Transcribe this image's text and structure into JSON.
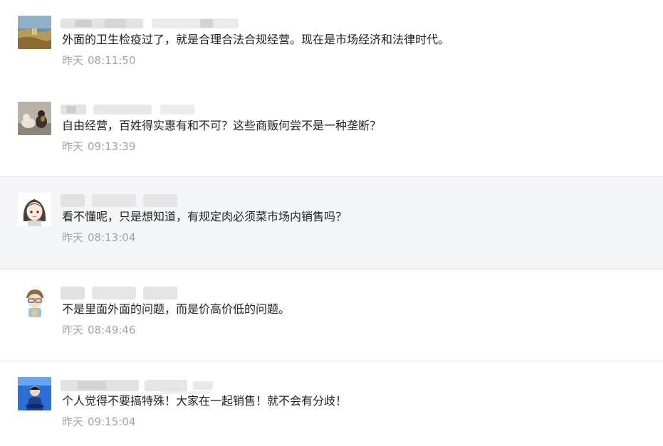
{
  "comments": [
    {
      "avatar": "landscape-avatar",
      "text": "外面的卫生检疫过了，就是合理合法合规经营。现在是市场经济和法律时代。",
      "day": "昨天",
      "time": "08:11:50"
    },
    {
      "avatar": "dogs-avatar",
      "text": "自由经营，百姓得实惠有和不可？这些商贩何尝不是一种垄断？",
      "day": "昨天",
      "time": "09:13:39"
    },
    {
      "avatar": "girl-cartoon-avatar",
      "text": "看不懂呢，只是想知道，有规定肉必须菜市场内销售吗？",
      "day": "昨天",
      "time": "08:13:04"
    },
    {
      "avatar": "boy-cartoon-avatar",
      "text": "不是里面外面的问题，而是价高价低的问题。",
      "day": "昨天",
      "time": "08:49:46"
    },
    {
      "avatar": "blue-figure-avatar",
      "text": "个人觉得不要搞特殊！大家在一起销售！就不会有分歧！",
      "day": "昨天",
      "time": "09:15:04"
    }
  ]
}
